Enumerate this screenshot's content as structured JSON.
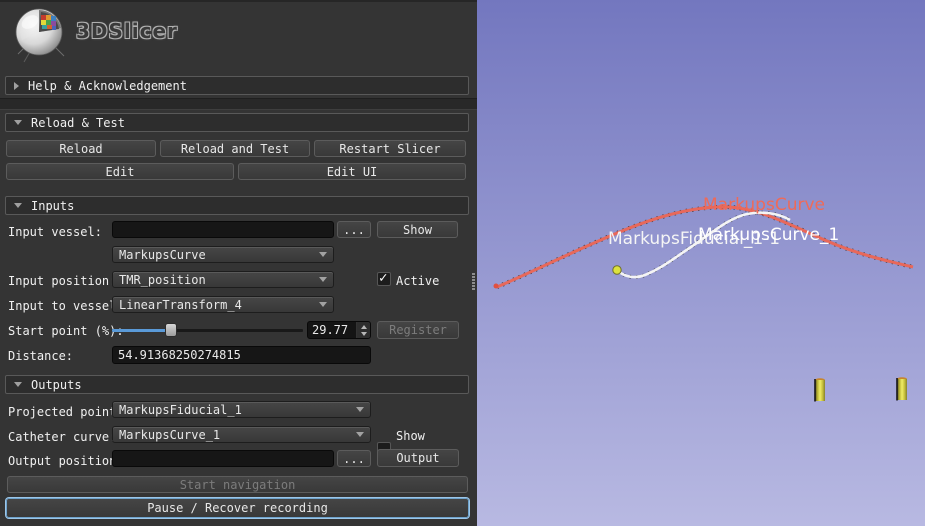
{
  "header": {
    "title": "3DSlicer"
  },
  "sections": {
    "help": "Help & Acknowledgement",
    "reload_test": "Reload & Test",
    "inputs": "Inputs",
    "outputs": "Outputs"
  },
  "reload": {
    "reload": "Reload",
    "reload_and_test": "Reload and Test",
    "restart": "Restart Slicer",
    "edit": "Edit",
    "edit_ui": "Edit UI"
  },
  "inputs": {
    "input_vessel": {
      "label": "Input vessel:",
      "value": "",
      "browse": "...",
      "show": "Show"
    },
    "vessel_type": {
      "value": "MarkupsCurve"
    },
    "input_position": {
      "label": "Input position:",
      "value": "TMR_position",
      "active_label": "Active",
      "active_checked": true
    },
    "input_to_vessel": {
      "label": "Input to vessel:",
      "value": "LinearTransform_4"
    },
    "start_point": {
      "label": "Start point (%):",
      "value": "29.77",
      "percent": 29.77,
      "register": "Register",
      "register_enabled": false
    },
    "distance": {
      "label": "Distance:",
      "value": "54.91368250274815"
    }
  },
  "outputs": {
    "projected_point": {
      "label": "Projected point:",
      "value": "MarkupsFiducial_1"
    },
    "catheter_curve": {
      "label": "Catheter curve:",
      "value": "MarkupsCurve_1",
      "show_label": "Show",
      "show_checked": false
    },
    "output_position": {
      "label": "Output position:",
      "value": "",
      "browse": "...",
      "output": "Output"
    }
  },
  "actions": {
    "start_navigation": "Start navigation",
    "start_navigation_enabled": false,
    "pause_recover": "Pause / Recover recording",
    "pause_recover_focused": true
  },
  "viewport": {
    "labels": {
      "red_curve": "MarkupsCurve",
      "white_curve": "MarkupsCurve_1",
      "fiducial": "MarkupsFiducial_1-1"
    },
    "colors": {
      "bg_top": "#7377bf",
      "bg_bottom": "#b8b9e2",
      "curve_red": "#e8685a",
      "curve_red_label": "#ef6a58",
      "curve_white": "#f4f4f4",
      "fiducial_dot": "#dce23e",
      "cylinder_yellow": "#e8e44c"
    }
  }
}
